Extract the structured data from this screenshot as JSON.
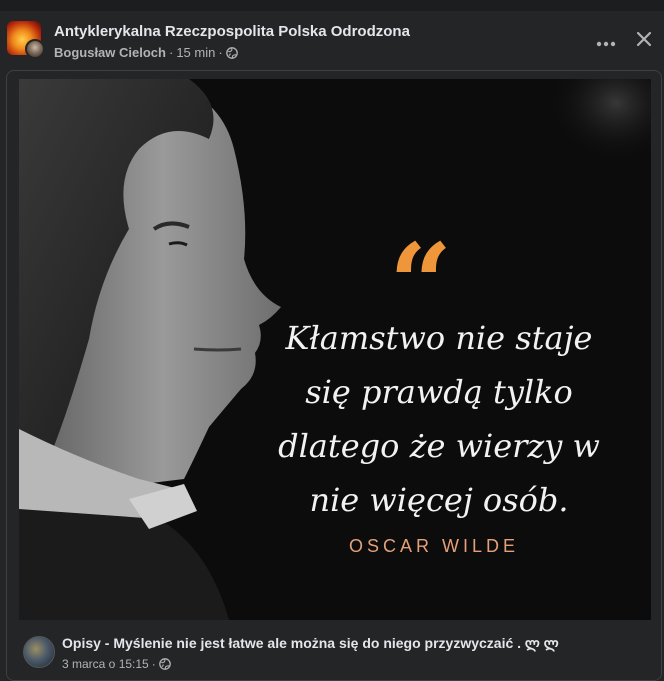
{
  "post": {
    "group_name": "Antyklerykalna Rzeczpospolita Polska Odrodzona",
    "author": "Bogusław Cieloch",
    "separator": "·",
    "time": "15 min",
    "audience_icon": "globe-icon",
    "more_icon": "more-horizontal-icon",
    "close_icon": "close-icon"
  },
  "image": {
    "quote_mark": "“",
    "quote_lines": [
      "Kłamstwo nie staje",
      "się prawdą tylko",
      "dlatego że wierzy w",
      "nie więcej osób."
    ],
    "author": "OSCAR WILDE"
  },
  "shared": {
    "text": "Opisy - Myślenie nie jest łatwe ale można się do niego przyzwyczaić . ლ ლ",
    "date": "3 marca o 15:15",
    "separator": "·",
    "audience_icon": "globe-icon"
  },
  "colors": {
    "background": "#242526",
    "text_primary": "#e4e6eb",
    "text_secondary": "#b0b3b8",
    "quote_accent": "#f0963a",
    "author_accent": "#e5a07a"
  }
}
